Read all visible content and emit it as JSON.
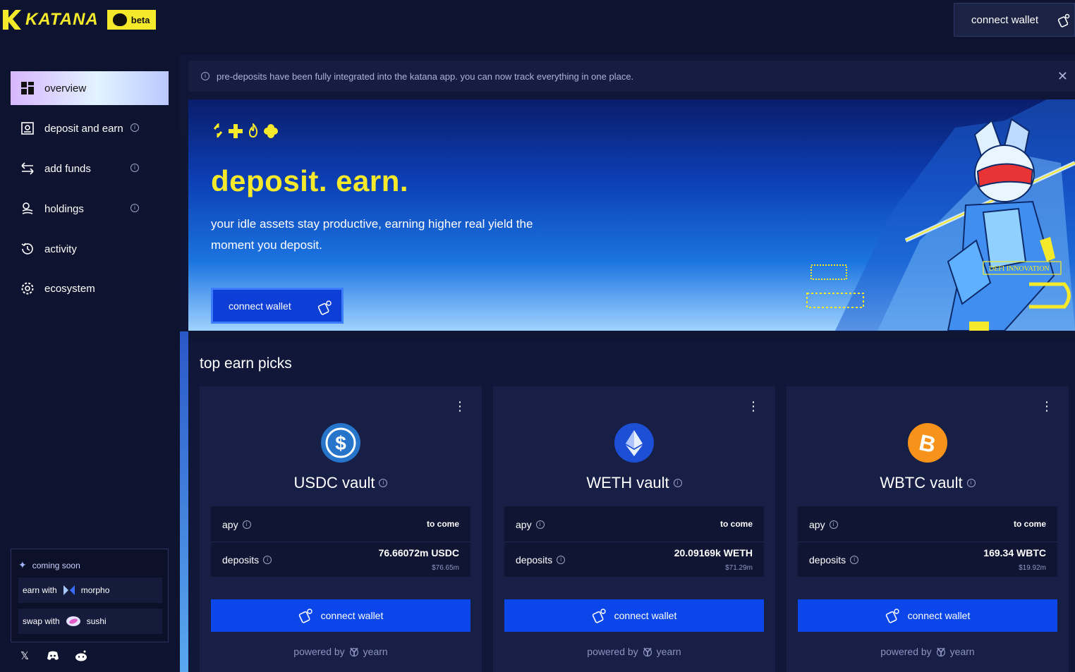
{
  "brand": {
    "name": "KATANA",
    "badge": "beta"
  },
  "header": {
    "connect_label": "connect wallet"
  },
  "sidebar": {
    "items": [
      {
        "label": "overview",
        "icon": "grid-icon",
        "active": true
      },
      {
        "label": "deposit and earn",
        "icon": "vault-icon"
      },
      {
        "label": "add funds",
        "icon": "swap-arrows-icon"
      },
      {
        "label": "holdings",
        "icon": "coins-stack-icon"
      },
      {
        "label": "activity",
        "icon": "history-icon"
      },
      {
        "label": "ecosystem",
        "icon": "gear-icon"
      }
    ],
    "coming_soon": {
      "title": "coming soon",
      "rows": [
        {
          "prefix": "earn with",
          "partner": "morpho"
        },
        {
          "prefix": "swap with",
          "partner": "sushi"
        }
      ]
    },
    "socials": [
      "x-icon",
      "discord-icon",
      "reddit-icon"
    ]
  },
  "banner": {
    "text": "pre-deposits have been fully integrated into the katana app. you can now track everything in one place."
  },
  "hero": {
    "title": "deposit. earn.",
    "subtitle": "your idle assets stay productive, earning higher real yield the moment you deposit.",
    "button": "connect wallet",
    "art_text": "DEFI INNOVATION"
  },
  "picks": {
    "title": "top earn picks",
    "cards": [
      {
        "name": "USDC vault",
        "coin_color": "#2775ca",
        "apy_label": "apy",
        "apy": "to come",
        "deposits_label": "deposits",
        "deposits": "76.66072m USDC",
        "deposits_usd": "$76.65m",
        "button": "connect wallet",
        "powered_prefix": "powered by",
        "powered_by": "yearn"
      },
      {
        "name": "WETH vault",
        "coin_color": "#1d4fd6",
        "apy_label": "apy",
        "apy": "to come",
        "deposits_label": "deposits",
        "deposits": "20.09169k WETH",
        "deposits_usd": "$71.29m",
        "button": "connect wallet",
        "powered_prefix": "powered by",
        "powered_by": "yearn"
      },
      {
        "name": "WBTC vault",
        "coin_color": "#f7931a",
        "apy_label": "apy",
        "apy": "to come",
        "deposits_label": "deposits",
        "deposits": "169.34 WBTC",
        "deposits_usd": "$19.92m",
        "button": "connect wallet",
        "powered_prefix": "powered by",
        "powered_by": "yearn"
      }
    ]
  },
  "colors": {
    "accent_yellow": "#f4ea2b",
    "primary_blue": "#0a46ea",
    "bg": "#0e1430"
  }
}
